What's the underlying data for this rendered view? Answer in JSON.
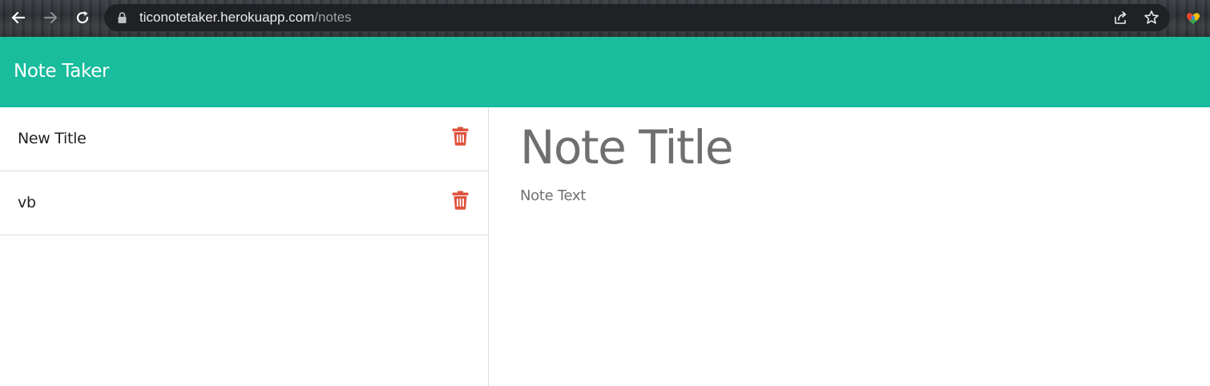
{
  "browser": {
    "url_host": "ticonotetaker.herokuapp.com",
    "url_path": "/notes",
    "icons": {
      "back": "arrow-left-icon",
      "forward": "arrow-right-icon",
      "reload": "reload-icon",
      "lock": "lock-icon",
      "share": "share-icon",
      "bookmark": "star-icon",
      "extension": "extension-icon"
    }
  },
  "header": {
    "title": "Note Taker",
    "background": "#19bc9c"
  },
  "notes": [
    {
      "title": "New Title",
      "delete_icon": "trash-icon"
    },
    {
      "title": "vb",
      "delete_icon": "trash-icon"
    }
  ],
  "editor": {
    "title_placeholder": "Note Title",
    "text_placeholder": "Note Text"
  },
  "colors": {
    "accent": "#19bc9c",
    "delete": "#e0533f",
    "divider": "#dcdcdc"
  }
}
